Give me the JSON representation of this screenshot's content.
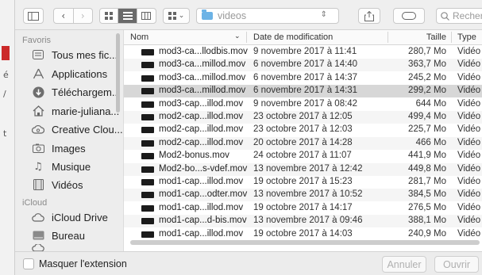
{
  "toolbar": {
    "path_folder": "videos",
    "search_placeholder": "Rechercher"
  },
  "sidebar": {
    "favorites_header": "Favoris",
    "favorites": [
      {
        "label": "Tous mes fic...",
        "icon": "all-files-icon"
      },
      {
        "label": "Applications",
        "icon": "applications-icon"
      },
      {
        "label": "Téléchargem...",
        "icon": "downloads-icon"
      },
      {
        "label": "marie-juliana...",
        "icon": "home-icon"
      },
      {
        "label": "Creative Clou...",
        "icon": "creative-cloud-icon"
      },
      {
        "label": "Images",
        "icon": "images-icon"
      },
      {
        "label": "Musique",
        "icon": "music-icon"
      },
      {
        "label": "Vidéos",
        "icon": "videos-icon"
      }
    ],
    "icloud_header": "iCloud",
    "icloud": [
      {
        "label": "iCloud Drive",
        "icon": "icloud-drive-icon"
      },
      {
        "label": "Bureau",
        "icon": "desktop-icon"
      }
    ]
  },
  "columns": {
    "name": "Nom",
    "date": "Date de modification",
    "size": "Taille",
    "type": "Type"
  },
  "files": [
    {
      "name": "mod3-ca...llodbis.mov",
      "date": "9 novembre 2017 à 11:41",
      "size": "280,7 Mo",
      "type": "Vidéo QT"
    },
    {
      "name": "mod3-ca...millod.mov",
      "date": "6 novembre 2017 à 14:40",
      "size": "363,7 Mo",
      "type": "Vidéo QT"
    },
    {
      "name": "mod3-ca...millod.mov",
      "date": "6 novembre 2017 à 14:37",
      "size": "245,2 Mo",
      "type": "Vidéo QT"
    },
    {
      "name": "mod3-ca...millod.mov",
      "date": "6 novembre 2017 à 14:31",
      "size": "299,2 Mo",
      "type": "Vidéo QT"
    },
    {
      "name": "mod3-cap...illod.mov",
      "date": "9 novembre 2017 à 08:42",
      "size": "644 Mo",
      "type": "Vidéo QT"
    },
    {
      "name": "mod2-cap...illod.mov",
      "date": "23 octobre 2017 à 12:05",
      "size": "499,4 Mo",
      "type": "Vidéo QT"
    },
    {
      "name": "mod2-cap...illod.mov",
      "date": "23 octobre 2017 à 12:03",
      "size": "225,7 Mo",
      "type": "Vidéo QT"
    },
    {
      "name": "mod2-cap...illod.mov",
      "date": "20 octobre 2017 à 14:28",
      "size": "466 Mo",
      "type": "Vidéo QT"
    },
    {
      "name": "Mod2-bonus.mov",
      "date": "24 octobre 2017 à 11:07",
      "size": "441,9 Mo",
      "type": "Vidéo QT"
    },
    {
      "name": "Mod2-bo...s-vdef.mov",
      "date": "13 novembre 2017 à 12:42",
      "size": "449,8 Mo",
      "type": "Vidéo QT"
    },
    {
      "name": "mod1-cap...illod.mov",
      "date": "19 octobre 2017 à 15:23",
      "size": "281,7 Mo",
      "type": "Vidéo QT"
    },
    {
      "name": "mod1-cap...odter.mov",
      "date": "13 novembre 2017 à 10:52",
      "size": "384,5 Mo",
      "type": "Vidéo QT"
    },
    {
      "name": "mod1-cap...illod.mov",
      "date": "19 octobre 2017 à 14:17",
      "size": "276,5 Mo",
      "type": "Vidéo QT"
    },
    {
      "name": "mod1-cap...d-bis.mov",
      "date": "13 novembre 2017 à 09:46",
      "size": "388,1 Mo",
      "type": "Vidéo QT"
    },
    {
      "name": "mod1-cap...illod.mov",
      "date": "19 octobre 2017 à 14:03",
      "size": "240,9 Mo",
      "type": "Vidéo QT"
    }
  ],
  "selected_row": 3,
  "bottom": {
    "hide_extension_label": "Masquer l'extension",
    "cancel_label": "Annuler",
    "open_label": "Ouvrir"
  },
  "colors": {
    "folder_accent": "#6cb3e6",
    "selected_row": "#d7d7d7"
  }
}
